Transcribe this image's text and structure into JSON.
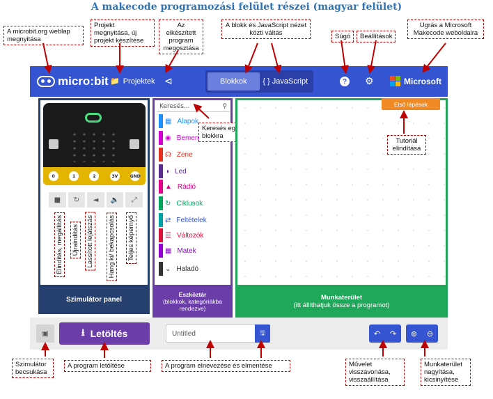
{
  "title": "A makecode programozási felület részei (magyar felület)",
  "colors": {
    "topbar": "#3454d1",
    "sim_panel": "#253f6e",
    "toolbox": "#6a3da8",
    "workspace": "#1fa75a",
    "callout_border": "#c00000",
    "title": "#2e74b5"
  },
  "callouts": {
    "microbit_org": "A microbit.org weblap megnyitása",
    "projects": "Projekt megnyitása, új projekt készítése",
    "share": "Az elkészített program megosztása",
    "toggle": "A blokk és JavaScript nézet közti váltás",
    "help": "Súgó",
    "settings": "Beállítások",
    "microsoft": "Ugrás a Microsoft Makecode weboldalra",
    "search": "Keresés egy blokkra",
    "tutorial": "Tutoriál elindítása",
    "collapse_sim": "Szimulátor becsukása",
    "download": "A program letöltése",
    "name_save": "A program elnevezése és elmentése",
    "undo": "Művelet visszavonása, visszaállítása",
    "zoom": "Munkaterület nagyítása, kicsinyítése"
  },
  "sim_labels": [
    "Elindítás, megállítás",
    "Újraindítás",
    "Lassított lejátszás",
    "Hang ki/ bekapcsolás",
    "Teljes képernyő"
  ],
  "header": {
    "logo": "micro:bit",
    "projects_label": "Projektek",
    "blocks_label": "Blokkok",
    "js_label": "{ } JavaScript",
    "microsoft_label": "Microsoft"
  },
  "toolbox": {
    "search_placeholder": "Keresés...",
    "categories": [
      {
        "label": "Alapok",
        "color": "#1e90ff",
        "icon": "grid-icon"
      },
      {
        "label": "Bemenet",
        "color": "#d400d4",
        "icon": "target-icon"
      },
      {
        "label": "Zene",
        "color": "#e63022",
        "icon": "headphones-icon"
      },
      {
        "label": "Led",
        "color": "#5c2d91",
        "icon": "toggle-icon"
      },
      {
        "label": "Rádió",
        "color": "#e3008c",
        "icon": "signal-icon"
      },
      {
        "label": "Ciklusok",
        "color": "#00a65a",
        "icon": "loop-icon"
      },
      {
        "label": "Feltételek",
        "color": "#00a4a6",
        "icon": "shuffle-icon"
      },
      {
        "label": "Változók",
        "color": "#dc143c",
        "icon": "list-icon"
      },
      {
        "label": "Matek",
        "color": "#9400d3",
        "icon": "calculator-icon"
      },
      {
        "label": "Haladó",
        "color": "#333333",
        "icon": "chevron-down-icon"
      }
    ],
    "footer": "Eszköztár",
    "footer_sub": "(blokkok, kategóriákba rendezve)"
  },
  "sim_panel_footer": "Szimulátor panel",
  "board_pins": [
    "0",
    "1",
    "2",
    "3V",
    "GND"
  ],
  "workspace": {
    "tutorial_button": "Első lépések",
    "footer": "Munkaterület",
    "footer_sub": "(itt állíthatjuk össze a programot)"
  },
  "bottom": {
    "download_label": "Letöltés",
    "project_name": "Untitled"
  }
}
